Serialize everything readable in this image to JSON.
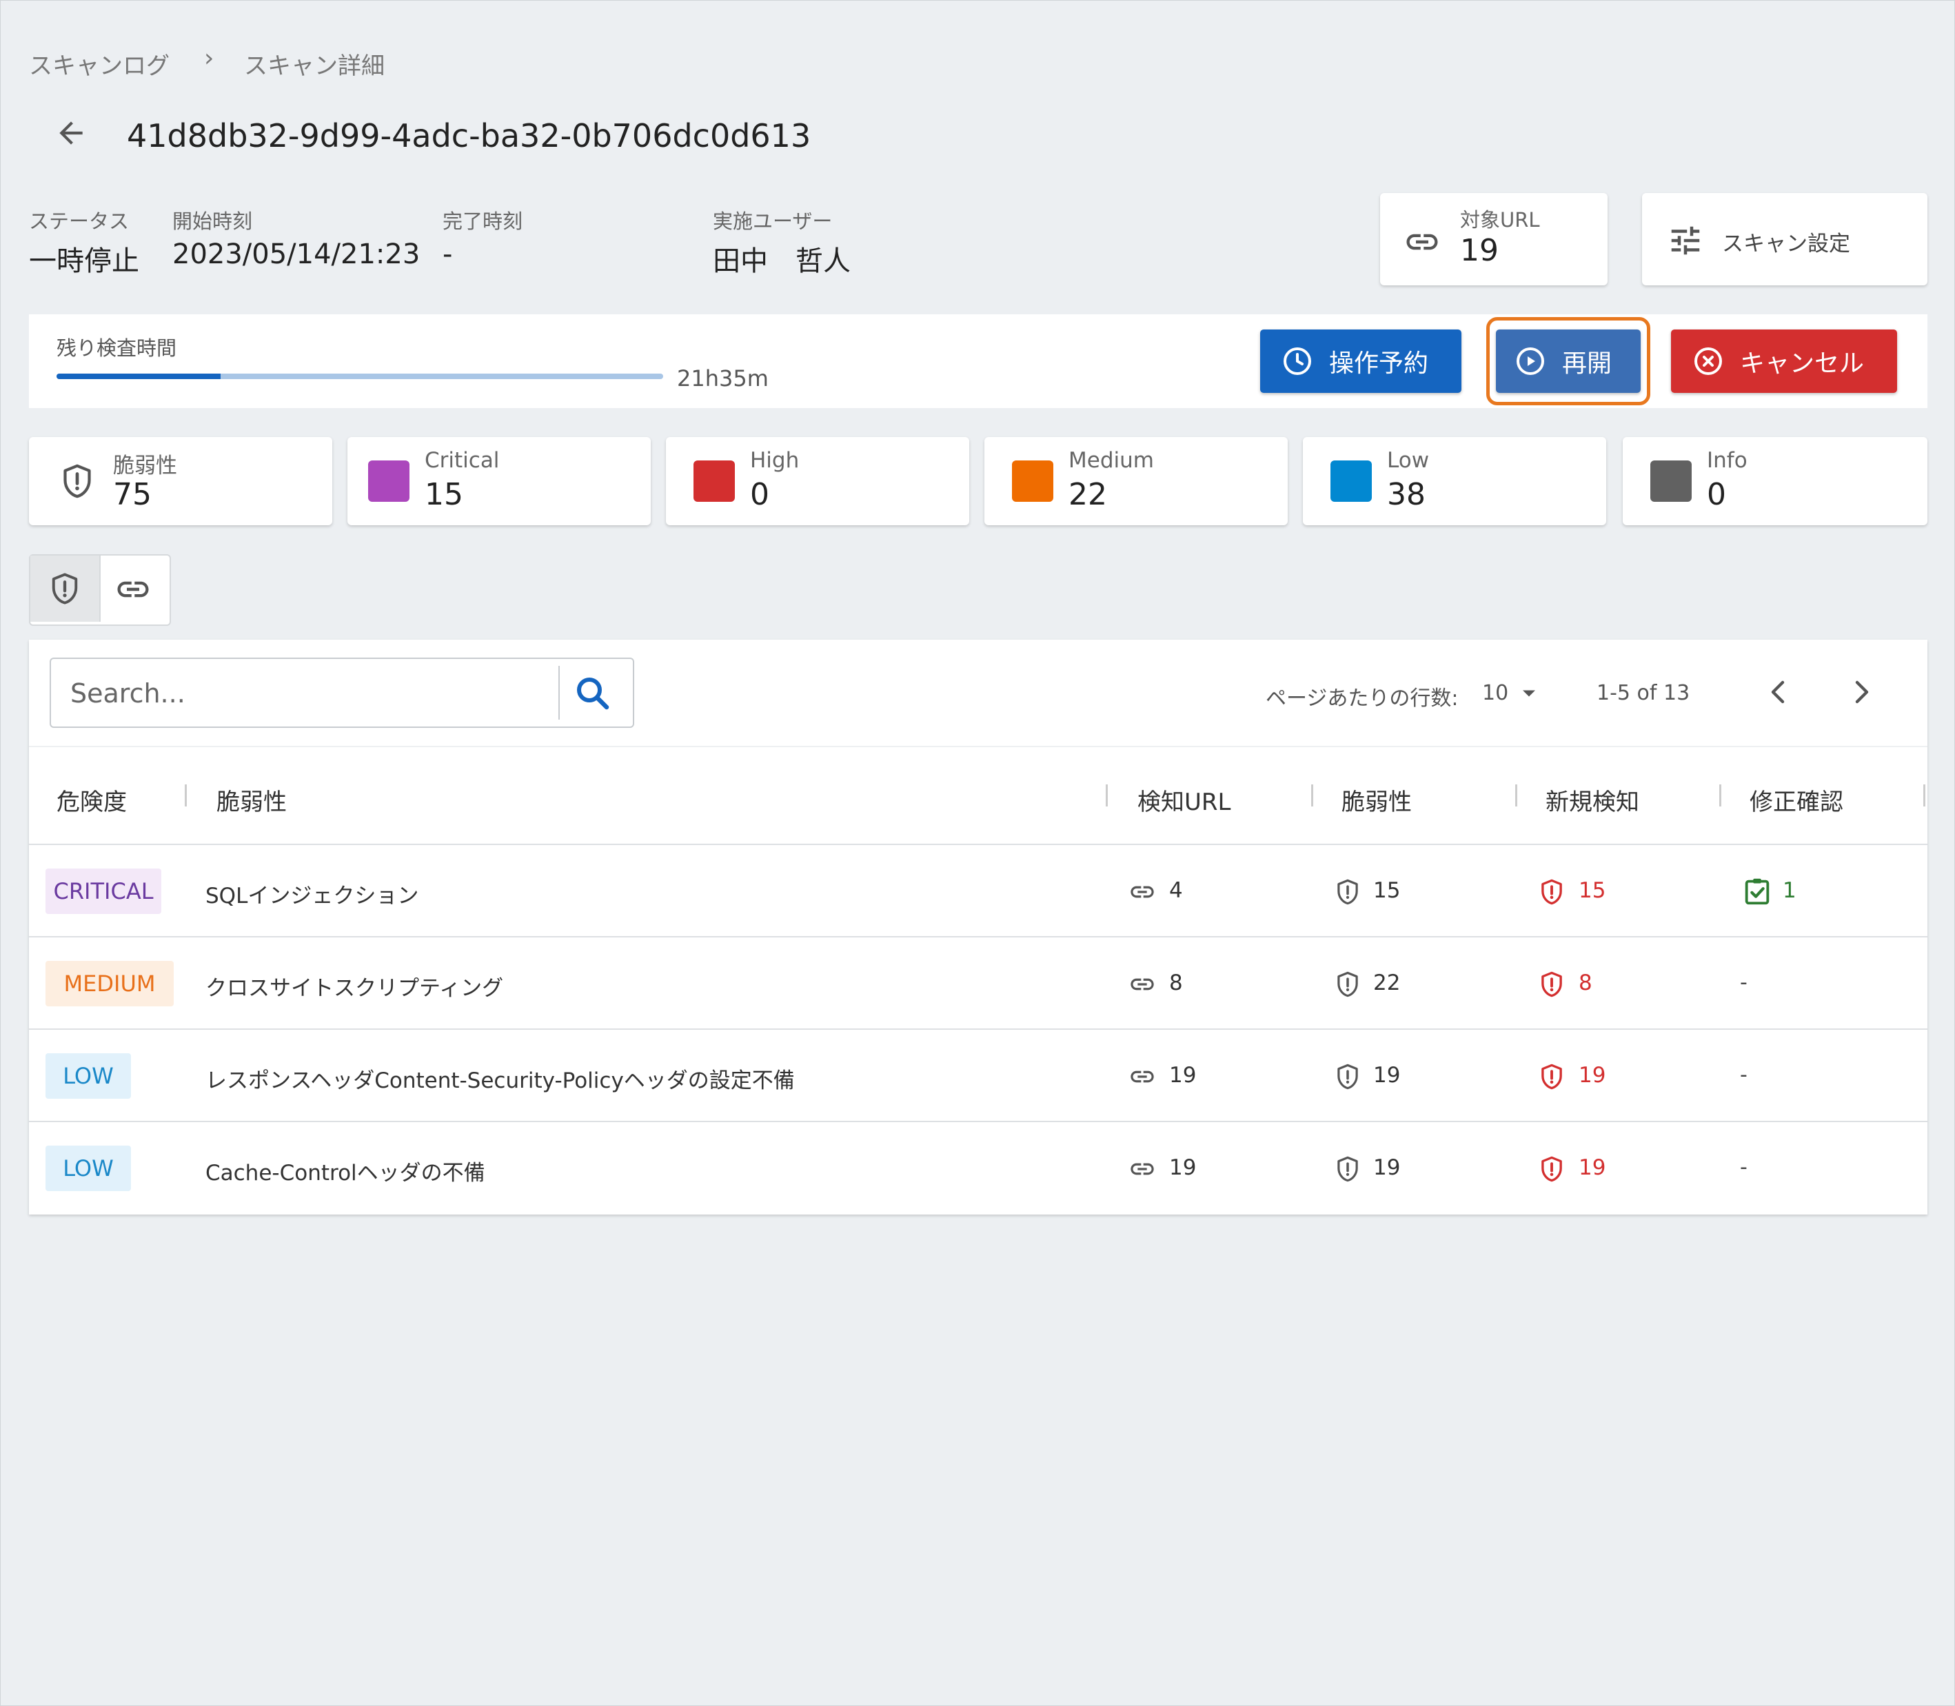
{
  "breadcrumb": {
    "items": [
      "スキャンログ",
      "スキャン詳細"
    ]
  },
  "scan": {
    "id": "41d8db32-9d99-4adc-ba32-0b706dc0d613",
    "status_label": "ステータス",
    "status": "一時停止",
    "start_label": "開始時刻",
    "start": "2023/05/14/21:23",
    "end_label": "完了時刻",
    "end": "-",
    "user_label": "実施ユーザー",
    "user": "田中　哲人"
  },
  "target": {
    "label": "対象URL",
    "value": "19",
    "icon": "link-icon"
  },
  "settings": {
    "label": "スキャン設定",
    "icon": "tune-icon"
  },
  "progress": {
    "label": "残り検査時間",
    "remaining": "21h35m",
    "fraction": 0.27
  },
  "actions": {
    "schedule": "操作予約",
    "resume": "再開",
    "cancel": "キャンセル"
  },
  "colors": {
    "primary": "#1565c0",
    "resume": "#3b6eb4",
    "highlight": "#e8781f",
    "cancel": "#d32f2f",
    "critical": "#ab47bc",
    "high": "#d32f2f",
    "medium": "#ef6c00",
    "low": "#0288d1",
    "info": "#616161"
  },
  "stats": {
    "total": {
      "label": "脆弱性",
      "value": "75"
    },
    "critical": {
      "label": "Critical",
      "value": "15"
    },
    "high": {
      "label": "High",
      "value": "0"
    },
    "medium": {
      "label": "Medium",
      "value": "22"
    },
    "low": {
      "label": "Low",
      "value": "38"
    },
    "info": {
      "label": "Info",
      "value": "0"
    }
  },
  "search": {
    "placeholder": "Search..."
  },
  "pager": {
    "rows_label": "ページあたりの行数:",
    "rows_value": "10",
    "range": "1-5 of 13"
  },
  "table": {
    "headers": [
      "危険度",
      "脆弱性",
      "検知URL",
      "脆弱性",
      "新規検知",
      "修正確認"
    ],
    "rows": [
      {
        "severity": "CRITICAL",
        "name": "SQLインジェクション",
        "urls": "4",
        "vulns": "15",
        "new": "15",
        "fixed": "1"
      },
      {
        "severity": "MEDIUM",
        "name": "クロスサイトスクリプティング",
        "urls": "8",
        "vulns": "22",
        "new": "8",
        "fixed": "-"
      },
      {
        "severity": "LOW",
        "name": "レスポンスヘッダContent-Security-Policyヘッダの設定不備",
        "urls": "19",
        "vulns": "19",
        "new": "19",
        "fixed": "-"
      },
      {
        "severity": "LOW",
        "name": "Cache-Controlヘッダの不備",
        "urls": "19",
        "vulns": "19",
        "new": "19",
        "fixed": "-"
      }
    ]
  }
}
